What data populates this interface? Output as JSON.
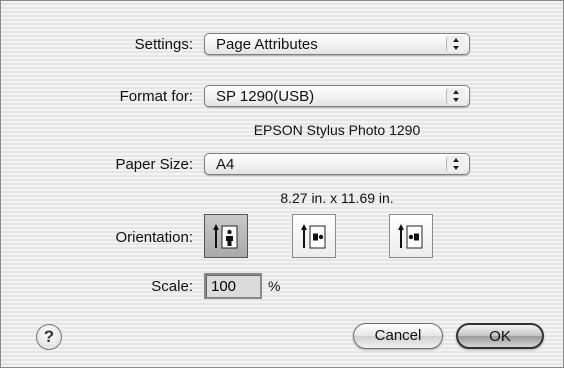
{
  "settings": {
    "label": "Settings:",
    "value": "Page Attributes"
  },
  "format": {
    "label": "Format for:",
    "value": "SP 1290(USB)",
    "description": "EPSON Stylus Photo 1290"
  },
  "paper": {
    "label": "Paper Size:",
    "value": "A4",
    "dimensions": "8.27 in. x 11.69 in."
  },
  "orientation": {
    "label": "Orientation:",
    "options": [
      {
        "name": "portrait",
        "icon": "portrait-icon",
        "selected": true
      },
      {
        "name": "landscape-left",
        "icon": "landscape-left-icon",
        "selected": false
      },
      {
        "name": "landscape-right",
        "icon": "landscape-right-icon",
        "selected": false
      }
    ]
  },
  "scale": {
    "label": "Scale:",
    "value": "100",
    "unit": "%"
  },
  "help": {
    "glyph": "?"
  },
  "buttons": {
    "cancel": "Cancel",
    "ok": "OK"
  }
}
